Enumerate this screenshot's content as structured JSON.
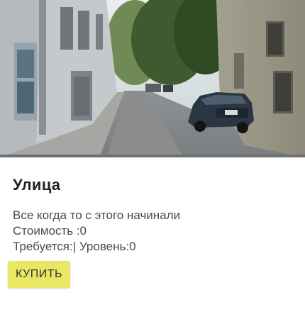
{
  "item": {
    "title": "Улица",
    "description": "Все когда то с этого начинали",
    "cost_line": "Стоимость :0",
    "requirements_line": "Требуется:| Уровень:0",
    "buy_label": "КУПИТЬ"
  },
  "colors": {
    "buy_button_bg": "#e8e865",
    "title_text": "#222222",
    "body_text": "#4a4a4a"
  }
}
